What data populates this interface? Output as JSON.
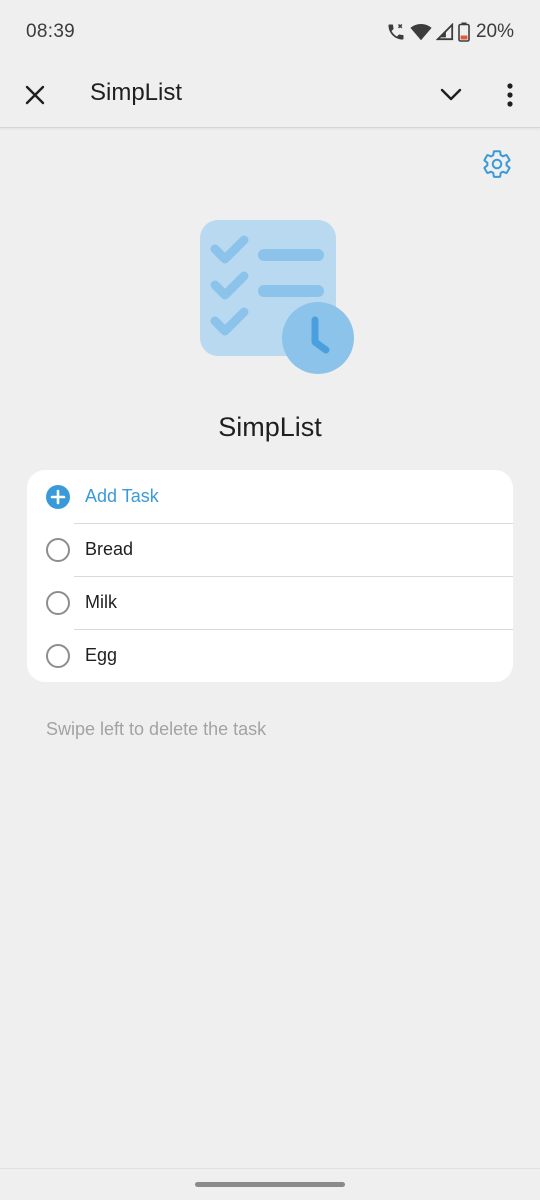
{
  "status": {
    "time": "08:39",
    "battery": "20%"
  },
  "toolbar": {
    "title": "SimpList"
  },
  "widget": {
    "title": "SimpList"
  },
  "tasks": {
    "add_label": "Add Task",
    "items": [
      "Bread",
      "Milk",
      "Egg"
    ]
  },
  "hint": "Swipe left to delete the task",
  "colors": {
    "accent": "#3a9ad9",
    "background": "#efefef",
    "card": "#ffffff",
    "hero_light": "#b9d9f1",
    "hero_mid": "#8cc3ea",
    "hero_dark": "#4a9fdf"
  }
}
